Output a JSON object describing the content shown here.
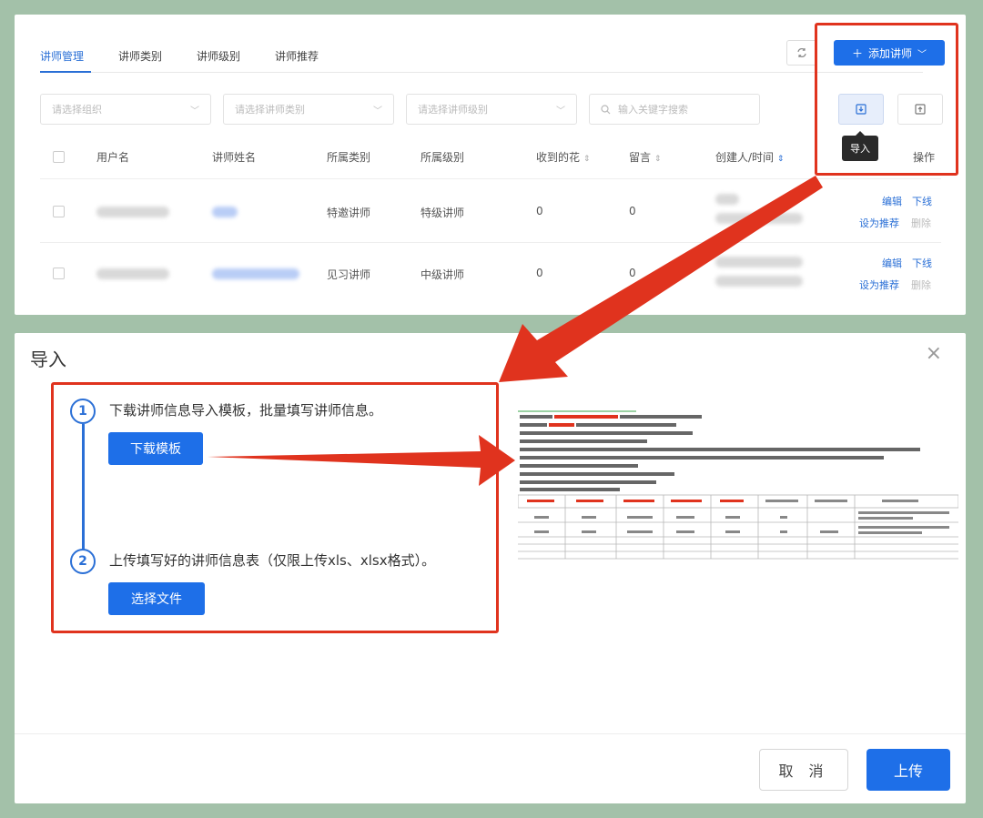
{
  "colors": {
    "accent": "#1e6fe8",
    "highlight": "#e0331e",
    "background": "#a3c1a9"
  },
  "tabs": [
    {
      "label": "讲师管理",
      "active": true
    },
    {
      "label": "讲师类别",
      "active": false
    },
    {
      "label": "讲师级别",
      "active": false
    },
    {
      "label": "讲师推荐",
      "active": false
    }
  ],
  "toolbar": {
    "add_label": "添加讲师",
    "import_tooltip": "导入"
  },
  "filters": {
    "org_placeholder": "请选择组织",
    "category_placeholder": "请选择讲师类别",
    "level_placeholder": "请选择讲师级别",
    "search_placeholder": "输入关键字搜索"
  },
  "table": {
    "headers": [
      "用户名",
      "讲师姓名",
      "所属类别",
      "所属级别",
      "收到的花",
      "留言",
      "创建人/时间",
      "操作"
    ],
    "rows": [
      {
        "category": "特邀讲师",
        "level": "特级讲师",
        "flowers": "0",
        "messages": "0"
      },
      {
        "category": "见习讲师",
        "level": "中级讲师",
        "flowers": "0",
        "messages": "0"
      }
    ],
    "ops": {
      "edit": "编辑",
      "offline": "下线",
      "recommend": "设为推荐",
      "delete": "删除"
    }
  },
  "dialog": {
    "title": "导入",
    "step1_num": "1",
    "step1_text": "下载讲师信息导入模板，批量填写讲师信息。",
    "step1_button": "下载模板",
    "step2_num": "2",
    "step2_text": "上传填写好的讲师信息表（仅限上传xls、xlsx格式）。",
    "step2_button": "选择文件",
    "cancel_label": "取 消",
    "upload_label": "上传"
  }
}
